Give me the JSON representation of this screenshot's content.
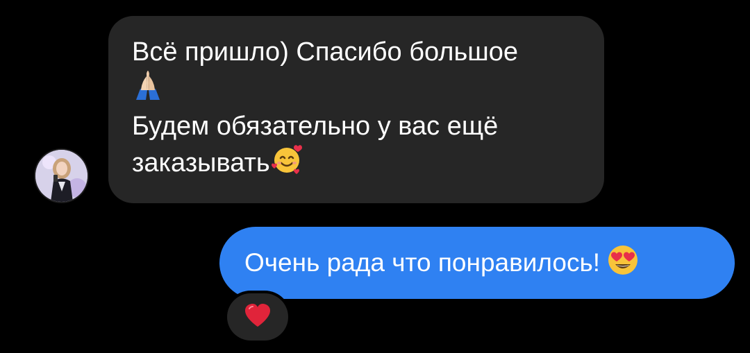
{
  "incoming_message": {
    "line1": "Всё пришло) Спасибо большое",
    "line2_emoji": "folded-hands-icon",
    "line3": "Будем обязательно у вас ещё",
    "line4": "заказывать",
    "line4_emoji": "smiling-face-with-hearts-icon"
  },
  "outgoing_message": {
    "text": "Очень рада что понравилось!",
    "emoji": "heart-eyes-icon"
  },
  "reaction": {
    "emoji": "red-heart-icon"
  },
  "colors": {
    "background": "#000000",
    "incoming_bubble": "#262626",
    "outgoing_bubble": "#2f81f2",
    "text": "#ffffff"
  }
}
